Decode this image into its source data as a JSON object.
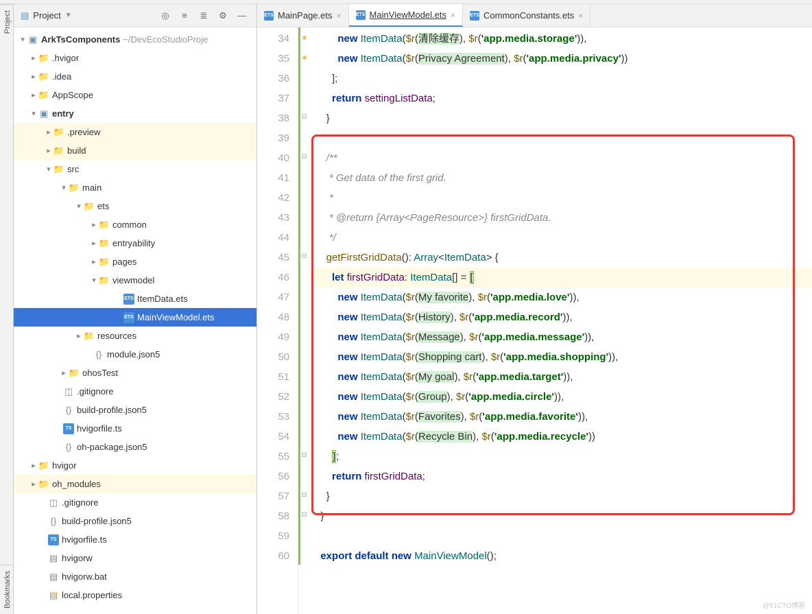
{
  "panel": {
    "title": "Project"
  },
  "project_root": {
    "name": "ArkTsComponents",
    "path": "~/DevEcoStudioProje"
  },
  "tree": {
    "hvigor_dot": ".hvigor",
    "idea": ".idea",
    "appscope": "AppScope",
    "entry": "entry",
    "preview": ".preview",
    "build": "build",
    "src": "src",
    "main": "main",
    "ets": "ets",
    "common": "common",
    "entryability": "entryability",
    "pages": "pages",
    "viewmodel": "viewmodel",
    "itemdata": "ItemData.ets",
    "mainviewmodel": "MainViewModel.ets",
    "resources": "resources",
    "module_json": "module.json5",
    "ohostest": "ohosTest",
    "gitignore": ".gitignore",
    "build_profile": "build-profile.json5",
    "hvigorfile_ts": "hvigorfile.ts",
    "oh_package": "oh-package.json5",
    "hvigor": "hvigor",
    "oh_modules": "oh_modules",
    "hvigorw": "hvigorw",
    "hvigorw_bat": "hvigorw.bat",
    "local_props": "local.properties"
  },
  "tabs": [
    {
      "label": "MainPage.ets"
    },
    {
      "label": "MainViewModel.ets"
    },
    {
      "label": "CommonConstants.ets"
    }
  ],
  "code": {
    "lines": [
      {
        "n": 34,
        "html": "        <span class='new-kw'>new</span> <span class='type'>ItemData</span>(<span class='fn'>$r</span>(<span class='str-bg'>清除缓存</span>), <span class='fn'>$r</span>(<span class='str'>'app.media.storage'</span>)),"
      },
      {
        "n": 35,
        "html": "        <span class='new-kw'>new</span> <span class='type'>ItemData</span>(<span class='fn'>$r</span>(<span class='str-bg'>Privacy Agreement</span>), <span class='fn'>$r</span>(<span class='str'>'app.media.privacy'</span>))"
      },
      {
        "n": 36,
        "html": "      ];"
      },
      {
        "n": 37,
        "html": "      <span class='kw'>return</span> <span class='var'>settingListData</span>;"
      },
      {
        "n": 38,
        "html": "    }"
      },
      {
        "n": 39,
        "html": ""
      },
      {
        "n": 40,
        "html": "    <span class='comment'>/**</span>"
      },
      {
        "n": 41,
        "html": "<span class='comment'>     * Get data of the first grid.</span>"
      },
      {
        "n": 42,
        "html": "<span class='comment'>     *</span>"
      },
      {
        "n": 43,
        "html": "<span class='comment'>     * @return {Array&lt;PageResource&gt;} firstGridData.</span>"
      },
      {
        "n": 44,
        "html": "<span class='comment'>     */</span>"
      },
      {
        "n": 45,
        "html": "    <span class='fn'>getFirstGridData</span>(): <span class='type'>Array</span>&lt;<span class='type'>ItemData</span>&gt; {"
      },
      {
        "n": 46,
        "html": "      <span class='kw'>let</span> <span class='var'>firstGridData</span>: <span class='type'>ItemData</span>[] = <span class='bracket-hl'>[</span>",
        "current": true
      },
      {
        "n": 47,
        "html": "        <span class='new-kw'>new</span> <span class='type'>ItemData</span>(<span class='fn'>$r</span>(<span class='str-bg'>My favorite</span>), <span class='fn'>$r</span>(<span class='str'>'app.media.love'</span>)),"
      },
      {
        "n": 48,
        "html": "        <span class='new-kw'>new</span> <span class='type'>ItemData</span>(<span class='fn'>$r</span>(<span class='str-bg'>History</span>), <span class='fn'>$r</span>(<span class='str'>'app.media.record'</span>)),"
      },
      {
        "n": 49,
        "html": "        <span class='new-kw'>new</span> <span class='type'>ItemData</span>(<span class='fn'>$r</span>(<span class='str-bg'>Message</span>), <span class='fn'>$r</span>(<span class='str'>'app.media.message'</span>)),"
      },
      {
        "n": 50,
        "html": "        <span class='new-kw'>new</span> <span class='type'>ItemData</span>(<span class='fn'>$r</span>(<span class='str-bg'>Shopping cart</span>), <span class='fn'>$r</span>(<span class='str'>'app.media.shopping'</span>)),"
      },
      {
        "n": 51,
        "html": "        <span class='new-kw'>new</span> <span class='type'>ItemData</span>(<span class='fn'>$r</span>(<span class='str-bg'>My goal</span>), <span class='fn'>$r</span>(<span class='str'>'app.media.target'</span>)),"
      },
      {
        "n": 52,
        "html": "        <span class='new-kw'>new</span> <span class='type'>ItemData</span>(<span class='fn'>$r</span>(<span class='str-bg'>Group</span>), <span class='fn'>$r</span>(<span class='str'>'app.media.circle'</span>)),"
      },
      {
        "n": 53,
        "html": "        <span class='new-kw'>new</span> <span class='type'>ItemData</span>(<span class='fn'>$r</span>(<span class='str-bg'>Favorites</span>), <span class='fn'>$r</span>(<span class='str'>'app.media.favorite'</span>)),"
      },
      {
        "n": 54,
        "html": "        <span class='new-kw'>new</span> <span class='type'>ItemData</span>(<span class='fn'>$r</span>(<span class='str-bg'>Recycle Bin</span>), <span class='fn'>$r</span>(<span class='str'>'app.media.recycle'</span>))"
      },
      {
        "n": 55,
        "html": "      <span class='bracket-hl'>]</span>;"
      },
      {
        "n": 56,
        "html": "      <span class='kw'>return</span> <span class='var'>firstGridData</span>;"
      },
      {
        "n": 57,
        "html": "    }"
      },
      {
        "n": 58,
        "html": "  }"
      },
      {
        "n": 59,
        "html": ""
      },
      {
        "n": 60,
        "html": "  <span class='kw'>export</span> <span class='kw'>default</span> <span class='kw'>new</span> <span class='type'>MainViewModel</span>();"
      }
    ]
  },
  "left_tabs": {
    "project": "Project",
    "bookmarks": "Bookmarks"
  },
  "watermark": "@51CTO博客"
}
